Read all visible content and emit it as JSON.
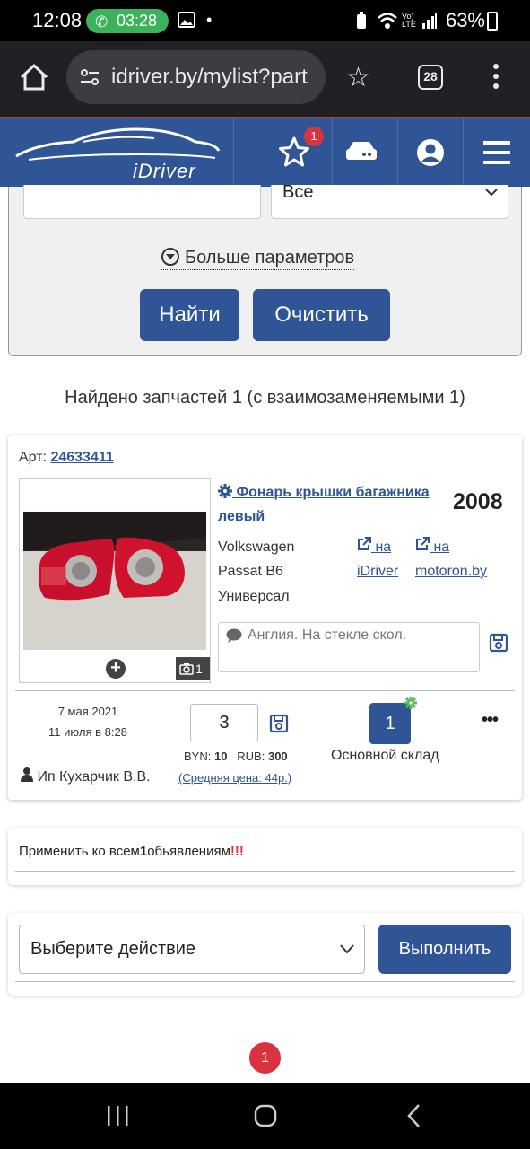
{
  "status_bar": {
    "time": "12:08",
    "call_timer": "03:28",
    "battery": "63%"
  },
  "browser": {
    "url": "idriver.by/mylist?part",
    "tab_count": "28"
  },
  "header": {
    "logo_text": "iDriver",
    "favorites_count": "1",
    "accent": "#2f5596"
  },
  "filters": {
    "select_value": "Все",
    "more_params": "Больше параметров",
    "find_label": "Найти",
    "clear_label": "Очистить"
  },
  "results_summary": "Найдено запчастей 1 (с взаимозаменяемыми 1)",
  "item": {
    "art_label": "Арт:",
    "art_number": "24633411",
    "title": "Фонарь крышки багажника левый",
    "year": "2008",
    "make": "Volkswagen",
    "model": "Passat B6",
    "body": "Универсал",
    "link1_line1": "на",
    "link1_line2": "iDriver",
    "link2_line1": "на",
    "link2_line2": "motoron.by",
    "photo_count": "1",
    "comment": "Англия. На стекле скол.",
    "date_created": "7 мая 2021",
    "date_updated": "11 июля в 8:28",
    "owner": "Ип Кухарчик В.В.",
    "quantity": "3",
    "byn_label": "BYN:",
    "byn_value": "10",
    "rub_label": "RUB:",
    "rub_value": "300",
    "avg_price": "(Средняя цена: 44р.)",
    "stock_count": "1",
    "stock_name": "Основной склад"
  },
  "apply_all": {
    "prefix": "Применить ко всем",
    "count": "1",
    "suffix": "обьявлениям",
    "marks": "!!!"
  },
  "action": {
    "select_placeholder": "Выберите действие",
    "run_label": "Выполнить"
  },
  "pagination": {
    "current_page": "1"
  }
}
